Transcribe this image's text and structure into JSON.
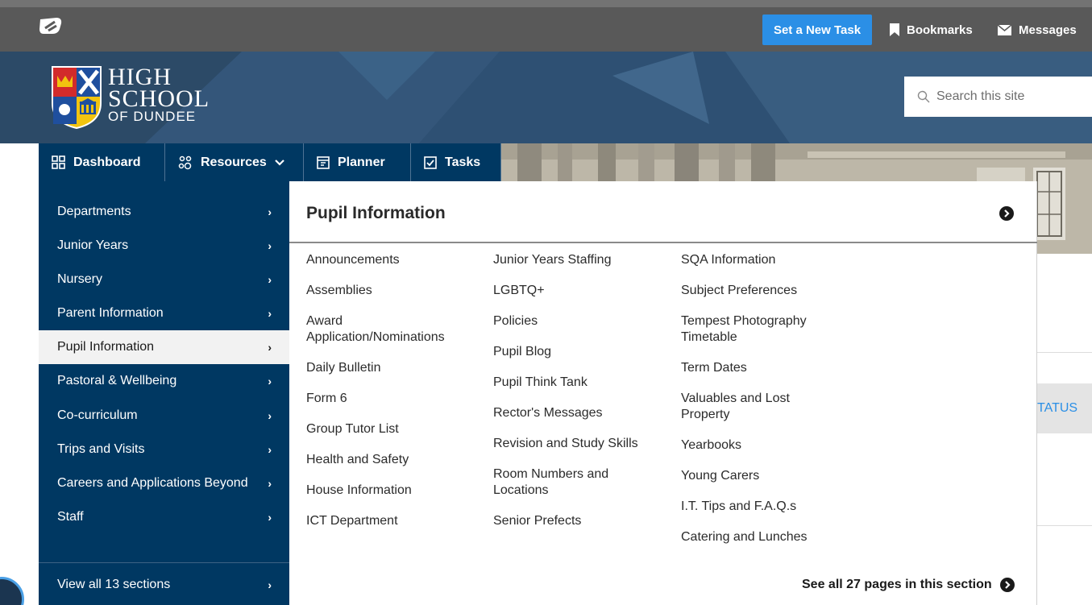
{
  "topbar": {
    "logo_icon": "school-app-logo-icon",
    "task_button": "Set a New Task",
    "bookmarks": "Bookmarks",
    "messages": "Messages"
  },
  "school": {
    "name_line1": "HIGH",
    "name_line2": "SCHOOL",
    "name_line3": "OF DUNDEE"
  },
  "search": {
    "placeholder": "Search this site"
  },
  "nav": {
    "dashboard": "Dashboard",
    "resources": "Resources",
    "planner": "Planner",
    "tasks": "Tasks"
  },
  "sidebar": {
    "items": [
      {
        "label": "Departments"
      },
      {
        "label": "Junior Years"
      },
      {
        "label": "Nursery"
      },
      {
        "label": "Parent Information"
      },
      {
        "label": "Pupil Information",
        "active": true
      },
      {
        "label": "Pastoral & Wellbeing"
      },
      {
        "label": "Co-curriculum"
      },
      {
        "label": "Trips and Visits"
      },
      {
        "label": "Careers and Applications Beyond"
      },
      {
        "label": "Staff"
      }
    ],
    "view_all": "View all 13 sections"
  },
  "section": {
    "title": "Pupil Information",
    "columns": [
      [
        "Announcements",
        "Assemblies",
        "Award Application/Nominations",
        "Daily Bulletin",
        "Form 6",
        "Group Tutor List",
        "Health and Safety",
        "House Information",
        "ICT Department"
      ],
      [
        "Junior Years Staffing",
        "LGBTQ+",
        "Policies",
        "Pupil Blog",
        "Pupil Think Tank",
        "Rector's Messages",
        "Revision and Study Skills",
        "Room Numbers and Locations",
        "Senior Prefects"
      ],
      [
        "SQA Information",
        "Subject Preferences",
        "Tempest Photography Timetable",
        "Term Dates",
        "Valuables and Lost Property",
        "Yearbooks",
        "Young Carers",
        "I.T. Tips and F.A.Q.s",
        "Catering and Lunches"
      ]
    ],
    "see_all": "See all 27 pages in this section"
  },
  "background": {
    "status_fragment": "TATUS"
  },
  "colors": {
    "navy": "#003862",
    "topbar": "#595959",
    "accent_blue": "#2b8fe6",
    "banner": "#2f4f6d"
  }
}
